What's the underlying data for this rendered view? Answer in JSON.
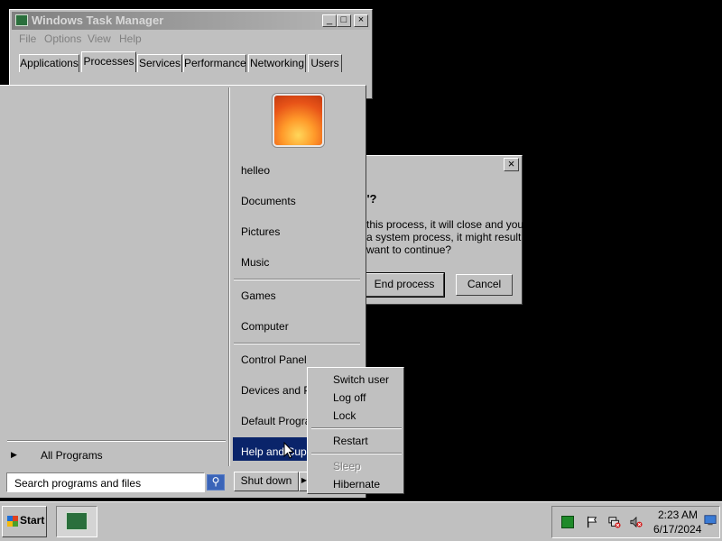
{
  "task_manager": {
    "title": "Windows Task Manager",
    "controls": {
      "minimize": "_",
      "maximize": "□",
      "close": "×"
    },
    "menu": [
      "File",
      "Options",
      "View",
      "Help"
    ],
    "tabs": [
      "Applications",
      "Processes",
      "Services",
      "Performance",
      "Networking",
      "Users"
    ],
    "active_tab": "Processes"
  },
  "dialog": {
    "close": "×",
    "heading_fragment": "ke'?",
    "body_lines": [
      "this process, it will close and you",
      "a system process, it might result in",
      "want to continue?"
    ],
    "end_button": "End process",
    "cancel_button": "Cancel"
  },
  "start_menu": {
    "all_programs_arrow": "▶",
    "all_programs": "All Programs",
    "search_placeholder": "Search programs and files",
    "search_icon_glyph": "⚲",
    "items": [
      "helleo",
      "Documents",
      "Pictures",
      "Music",
      "Games",
      "Computer",
      "Control Panel",
      "Devices and Pr",
      "Default Program",
      "Help and Suppo"
    ],
    "shutdown_label": "Shut down",
    "shutdown_arrow": "▶"
  },
  "shutdown_flyout": {
    "items": [
      "Switch user",
      "Log off",
      "Lock",
      "Restart",
      "Sleep",
      "Hibernate"
    ],
    "disabled": [
      "Sleep"
    ]
  },
  "taskbar": {
    "start_label": "Start",
    "clock_time": "2:23 AM",
    "clock_date": "6/17/2024",
    "tray_icons": [
      "action-center-icon",
      "flag-icon",
      "network-error-icon",
      "volume-muted-icon",
      "show-desktop-icon"
    ],
    "colors": {
      "selection": "#0a246a",
      "face": "#c0c0c0"
    }
  }
}
